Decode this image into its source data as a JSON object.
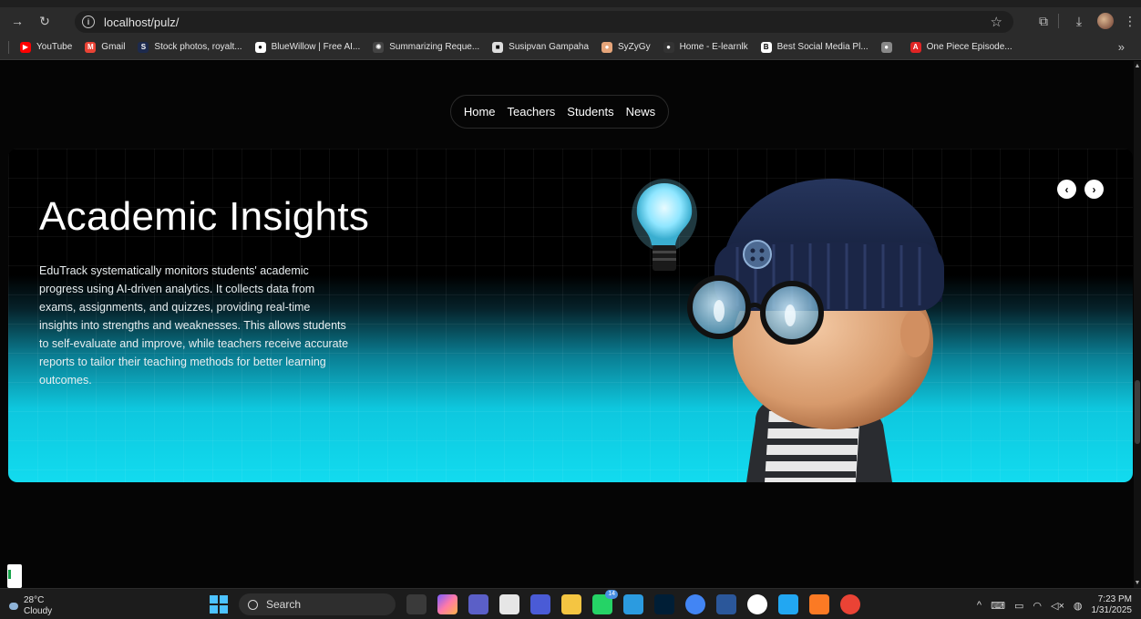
{
  "browser": {
    "url": "localhost/pulz/",
    "bookmarks": [
      {
        "label": "YouTube",
        "color": "#ff0000",
        "glyph": "▶"
      },
      {
        "label": "Gmail",
        "color": "#ea4335",
        "glyph": "M"
      },
      {
        "label": "Stock photos, royalt...",
        "color": "#1d2a4d",
        "glyph": "S"
      },
      {
        "label": "BlueWillow | Free AI...",
        "color": "#ffffff",
        "glyph": "●"
      },
      {
        "label": "Summarizing Reque...",
        "color": "#444444",
        "glyph": "✺"
      },
      {
        "label": "Susipvan Gampaha",
        "color": "#dddddd",
        "glyph": "■"
      },
      {
        "label": "SyZyGy",
        "color": "#e6a57a",
        "glyph": "●"
      },
      {
        "label": "Home - E-learnlk",
        "color": "#333333",
        "glyph": "●"
      },
      {
        "label": "Best Social Media Pl...",
        "color": "#ffffff",
        "glyph": "B"
      },
      {
        "label": "",
        "color": "#888888",
        "glyph": "●"
      },
      {
        "label": "One Piece Episode...",
        "color": "#e02424",
        "glyph": "A"
      }
    ],
    "more": "»"
  },
  "nav": {
    "items": [
      "Home",
      "Teachers",
      "Students",
      "News"
    ]
  },
  "hero": {
    "title": "Academic Insights",
    "description": "EduTrack systematically monitors students' academic progress using AI-driven analytics. It collects data from exams, assignments, and quizzes, providing real-time insights into strengths and weaknesses. This allows students to self-evaluate and improve, while teachers receive accurate reports to tailor their teaching methods for better learning outcomes.",
    "prev_label": "‹",
    "next_label": "›"
  },
  "taskbar": {
    "weather_temp": "28°C",
    "weather_desc": "Cloudy",
    "search_label": "Search",
    "whatsapp_badge": "14",
    "time": "7:23 PM",
    "date": "1/31/2025",
    "apps": [
      {
        "name": "file-explorer-app",
        "color": "#f4c542"
      },
      {
        "name": "whatsapp-app",
        "color": "#25d366"
      },
      {
        "name": "edge-app",
        "color": "#2b9be0"
      },
      {
        "name": "photoshop-app",
        "color": "#001e36"
      },
      {
        "name": "chrome-app",
        "color": "#4285f4"
      },
      {
        "name": "word-app",
        "color": "#2b579a"
      },
      {
        "name": "github-app",
        "color": "#ffffff"
      },
      {
        "name": "vscode-app",
        "color": "#22a7f2"
      },
      {
        "name": "xampp-app",
        "color": "#fb7a24"
      },
      {
        "name": "chrome-profile-app",
        "color": "#ea4335"
      }
    ]
  },
  "colors": {
    "accent_cyan": "#12dbef",
    "page_bg": "#050505"
  }
}
